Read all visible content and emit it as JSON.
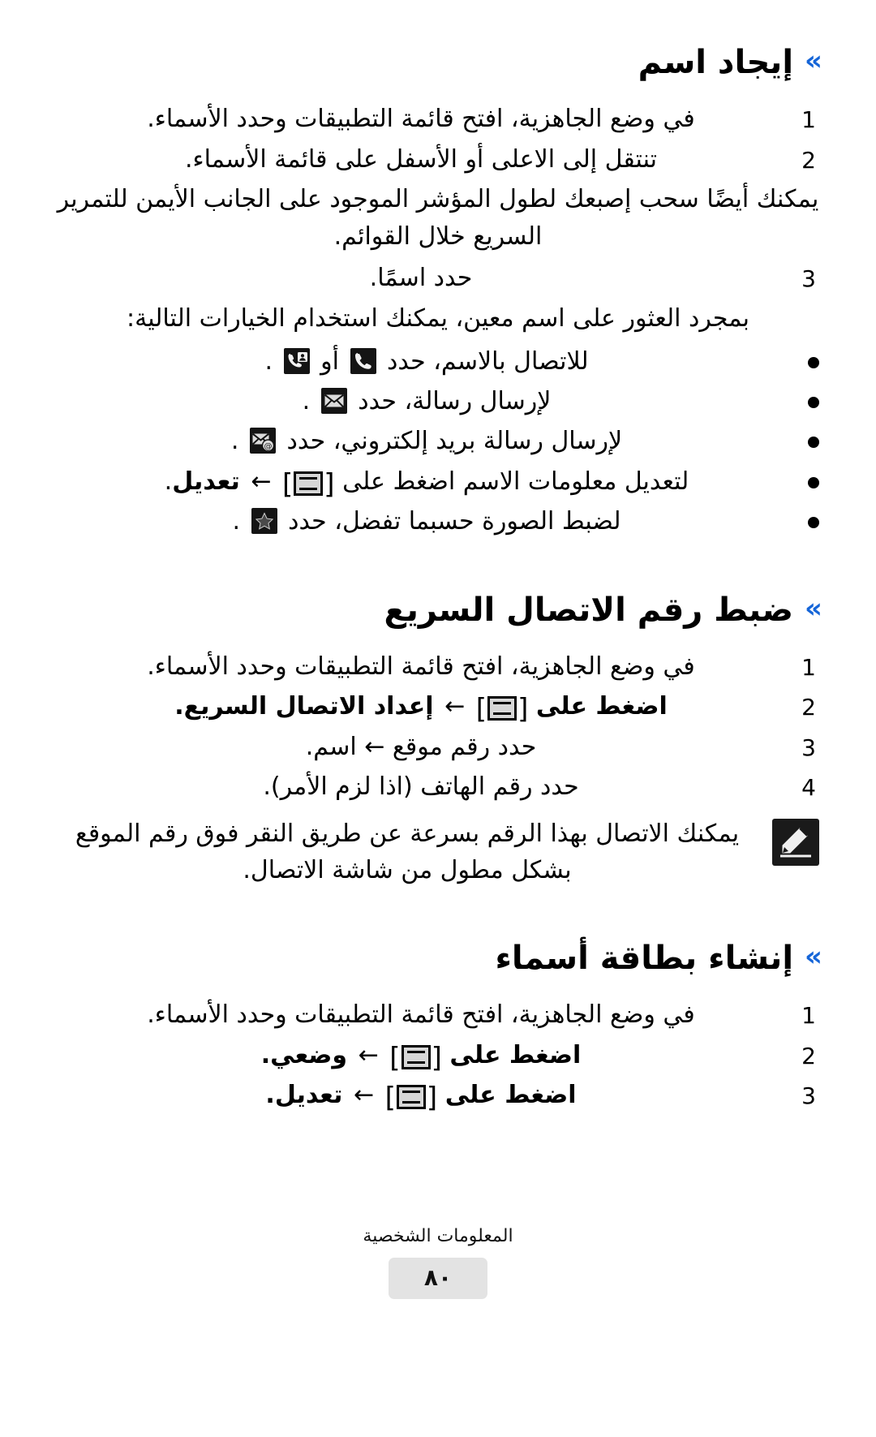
{
  "document": {
    "language": "ar",
    "direction": "rtl"
  },
  "accent_color": "#1565d8",
  "sections": [
    {
      "id": "find-name",
      "chevron": "»",
      "title": "إيجاد اسم",
      "steps": [
        {
          "num": "1",
          "text": "في وضع الجاهزية، افتح قائمة التطبيقات وحدد الأسماء."
        },
        {
          "num": "2",
          "text": "تنتقل إلى الاعلى أو الأسفل على قائمة الأسماء."
        }
      ],
      "continuation": "يمكنك أيضًا سحب إصبعك لطول المؤشر الموجود على الجانب الأيمن للتمرير السريع خلال القوائم.",
      "steps2": [
        {
          "num": "3",
          "text": "حدد اسمًا."
        }
      ],
      "after_text": "بمجرد العثور على اسم معين، يمكنك استخدام الخيارات التالية:",
      "bullets": [
        {
          "id": "call-by-name",
          "before": "للاتصال بالاسم، حدد",
          "icons": [
            "phone-handset-icon",
            "video-contact-icon"
          ],
          "separator": "أو",
          "after": "."
        },
        {
          "id": "send-message",
          "before": "لإرسال رسالة، حدد",
          "icons": [
            "envelope-icon"
          ],
          "separator": "",
          "after": "."
        },
        {
          "id": "send-email",
          "before": "لإرسال رسالة بريد إلكتروني، حدد",
          "icons": [
            "email-at-icon"
          ],
          "separator": "",
          "after": "."
        },
        {
          "id": "edit-name-info",
          "before": "لتعديل معلومات الاسم اضغط على",
          "icons": [
            "menu-key-icon"
          ],
          "arrow": "←",
          "bold_after": "تعديل",
          "after": "."
        },
        {
          "id": "set-favorite-image",
          "before": "لضبط الصورة حسبما تفضل، حدد",
          "icons": [
            "star-icon"
          ],
          "separator": "",
          "after": "."
        }
      ]
    },
    {
      "id": "set-speed-dial",
      "chevron": "»",
      "title": "ضبط رقم الاتصال السريع",
      "steps": [
        {
          "num": "1",
          "text": "في وضع الجاهزية، افتح قائمة التطبيقات وحدد الأسماء."
        },
        {
          "num": "2",
          "text_before": "اضغط على",
          "menu_key": true,
          "arrow": "←",
          "bold_after": "إعداد الاتصال السريع",
          "text_after": "."
        },
        {
          "num": "3",
          "text": "حدد رقم موقع ← اسم."
        },
        {
          "num": "4",
          "text": "حدد رقم الهاتف (اذا لزم الأمر)."
        }
      ],
      "note": {
        "icon": "note-pencil-icon",
        "text": "يمكنك الاتصال بهذا الرقم بسرعة عن طريق النقر فوق رقم الموقع بشكل مطول من شاشة الاتصال."
      }
    },
    {
      "id": "create-name-card",
      "chevron": "»",
      "title": "إنشاء بطاقة أسماء",
      "steps": [
        {
          "num": "1",
          "text": "في وضع الجاهزية، افتح قائمة التطبيقات وحدد الأسماء."
        },
        {
          "num": "2",
          "text_before": "اضغط على",
          "menu_key": true,
          "arrow": "←",
          "bold_after": "وضعي",
          "text_after": "."
        },
        {
          "num": "3",
          "text_before": "اضغط على",
          "menu_key": true,
          "arrow": "←",
          "bold_after": "تعديل",
          "text_after": "."
        }
      ]
    }
  ],
  "footer": {
    "section_title": "المعلومات الشخصية",
    "page_number": "٨٠"
  }
}
